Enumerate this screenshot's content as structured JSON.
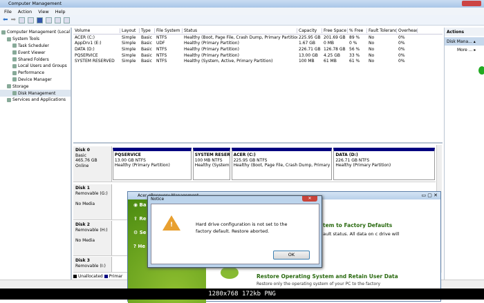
{
  "window": {
    "title": "Computer Management"
  },
  "menu": [
    "File",
    "Action",
    "View",
    "Help"
  ],
  "tree": [
    {
      "label": "Computer Management (Local",
      "level": 0
    },
    {
      "label": "System Tools",
      "level": 1
    },
    {
      "label": "Task Scheduler",
      "level": 2
    },
    {
      "label": "Event Viewer",
      "level": 2
    },
    {
      "label": "Shared Folders",
      "level": 2
    },
    {
      "label": "Local Users and Groups",
      "level": 2
    },
    {
      "label": "Performance",
      "level": 2
    },
    {
      "label": "Device Manager",
      "level": 2
    },
    {
      "label": "Storage",
      "level": 1
    },
    {
      "label": "Disk Management",
      "level": 2
    },
    {
      "label": "Services and Applications",
      "level": 1
    }
  ],
  "volumes": {
    "columns": [
      "Volume",
      "Layout",
      "Type",
      "File System",
      "Status",
      "Capacity",
      "Free Space",
      "% Free",
      "Fault Tolerance",
      "Overhead"
    ],
    "rows": [
      [
        "ACER (C:)",
        "Simple",
        "Basic",
        "NTFS",
        "Healthy (Boot, Page File, Crash Dump, Primary Partition)",
        "225.95 GB",
        "201.69 GB",
        "89 %",
        "No",
        "0%"
      ],
      [
        "AppDrv1 (E:)",
        "Simple",
        "Basic",
        "UDF",
        "Healthy (Primary Partition)",
        "1.67 GB",
        "0 MB",
        "0 %",
        "No",
        "0%"
      ],
      [
        "DATA (D:)",
        "Simple",
        "Basic",
        "NTFS",
        "Healthy (Primary Partition)",
        "226.71 GB",
        "126.78 GB",
        "56 %",
        "No",
        "0%"
      ],
      [
        "PQSERVICE",
        "Simple",
        "Basic",
        "NTFS",
        "Healthy (Primary Partition)",
        "13.00 GB",
        "4.25 GB",
        "33 %",
        "No",
        "0%"
      ],
      [
        "SYSTEM RESERVED",
        "Simple",
        "Basic",
        "NTFS",
        "Healthy (System, Active, Primary Partition)",
        "100 MB",
        "61 MB",
        "61 %",
        "No",
        "0%"
      ]
    ]
  },
  "actions": {
    "title": "Actions",
    "item": "Disk Mana...",
    "more": "More ..."
  },
  "disks": [
    {
      "name": "Disk 0",
      "l1": "Basic",
      "l2": "465.76 GB",
      "l3": "Online",
      "parts": [
        {
          "name": "PQSERVICE",
          "size": "13.00 GB NTFS",
          "status": "Healthy (Primary Partition)"
        },
        {
          "name": "SYSTEM RESER'",
          "size": "100 MB NTFS",
          "status": "Healthy (System"
        },
        {
          "name": "ACER  (C:)",
          "size": "225.95 GB NTFS",
          "status": "Healthy (Boot, Page File, Crash Dump, Primary P"
        },
        {
          "name": "DATA  (D:)",
          "size": "226.71 GB NTFS",
          "status": "Healthy (Primary Partition)"
        }
      ]
    },
    {
      "name": "Disk 1",
      "l1": "Removable (G:)",
      "l2": "",
      "l3": "No Media"
    },
    {
      "name": "Disk 2",
      "l1": "Removable (H:)",
      "l2": "",
      "l3": "No Media"
    },
    {
      "name": "Disk 3",
      "l1": "Removable (I:)",
      "l2": "",
      "l3": ""
    }
  ],
  "legend": {
    "unallocated": "Unallocated",
    "primary": "Primar"
  },
  "acer": {
    "title": "Acer eRecovery Management",
    "side": [
      "Ba",
      "Re",
      "Se",
      "He"
    ],
    "h1": "tem to Factory Defaults",
    "t1": "ault status. All data on c drive will",
    "h2": "Restore Operating System and Retain User Data",
    "t2": "Restore only the operating system of your PC to the factory"
  },
  "notice": {
    "title": "Notice",
    "message": "Hard drive configuration is not set to the factory default. Restore aborted.",
    "ok": "OK"
  },
  "footer": "1280x768 172kb PNG"
}
